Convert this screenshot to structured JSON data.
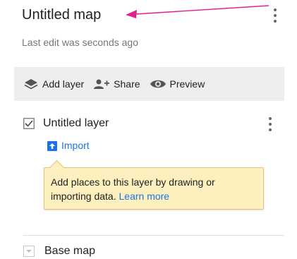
{
  "header": {
    "title": "Untitled map",
    "subtitle": "Last edit was seconds ago"
  },
  "toolbar": {
    "add_layer": "Add layer",
    "share": "Share",
    "preview": "Preview"
  },
  "layer": {
    "name": "Untitled layer",
    "checked": true,
    "import_label": "Import"
  },
  "tooltip": {
    "text": "Add places to this layer by drawing or importing data.",
    "link": "Learn more"
  },
  "basemap": {
    "label": "Base map"
  },
  "colors": {
    "accent": "#1a73e8",
    "arrow": "#e0218a",
    "tooltip_bg": "#fdf0bf",
    "toolbar_bg": "#eeeeee"
  }
}
